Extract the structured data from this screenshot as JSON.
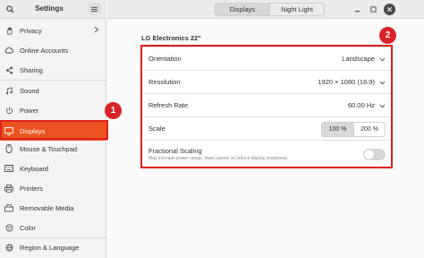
{
  "sidebar": {
    "title": "Settings",
    "items": [
      {
        "label": "Privacy",
        "icon": "hand-icon"
      },
      {
        "label": "Online Accounts",
        "icon": "cloud-icon"
      },
      {
        "label": "Sharing",
        "icon": "share-icon"
      },
      {
        "label": "Sound",
        "icon": "music-note-icon"
      },
      {
        "label": "Power",
        "icon": "power-icon"
      },
      {
        "label": "Displays",
        "icon": "display-icon"
      },
      {
        "label": "Mouse & Touchpad",
        "icon": "mouse-icon"
      },
      {
        "label": "Keyboard",
        "icon": "keyboard-icon"
      },
      {
        "label": "Printers",
        "icon": "printer-icon"
      },
      {
        "label": "Removable Media",
        "icon": "media-icon"
      },
      {
        "label": "Color",
        "icon": "color-icon"
      },
      {
        "label": "Region & Language",
        "icon": "globe-icon"
      }
    ],
    "active": "Displays"
  },
  "tabs": [
    {
      "label": "Displays",
      "active": true
    },
    {
      "label": "Night Light",
      "active": false
    }
  ],
  "main": {
    "monitor_name": "LG Electronics 22\"",
    "rows": {
      "orientation": {
        "label": "Orientation",
        "value": "Landscape"
      },
      "resolution": {
        "label": "Resolution",
        "value": "1920 × 1080 (16:9)"
      },
      "refresh_rate": {
        "label": "Refresh Rate",
        "value": "60.00 Hz"
      },
      "scale": {
        "label": "Scale",
        "options": [
          "100 %",
          "200 %"
        ],
        "selected": "100 %"
      },
      "fractional_scaling": {
        "label": "Fractional Scaling",
        "description": "May increase power usage, lower speed, or reduce display sharpness.",
        "enabled": false
      }
    }
  },
  "annotations": {
    "badge1": "1",
    "badge2": "2"
  },
  "colors": {
    "accent": "#e95420",
    "highlight": "#e02020"
  }
}
